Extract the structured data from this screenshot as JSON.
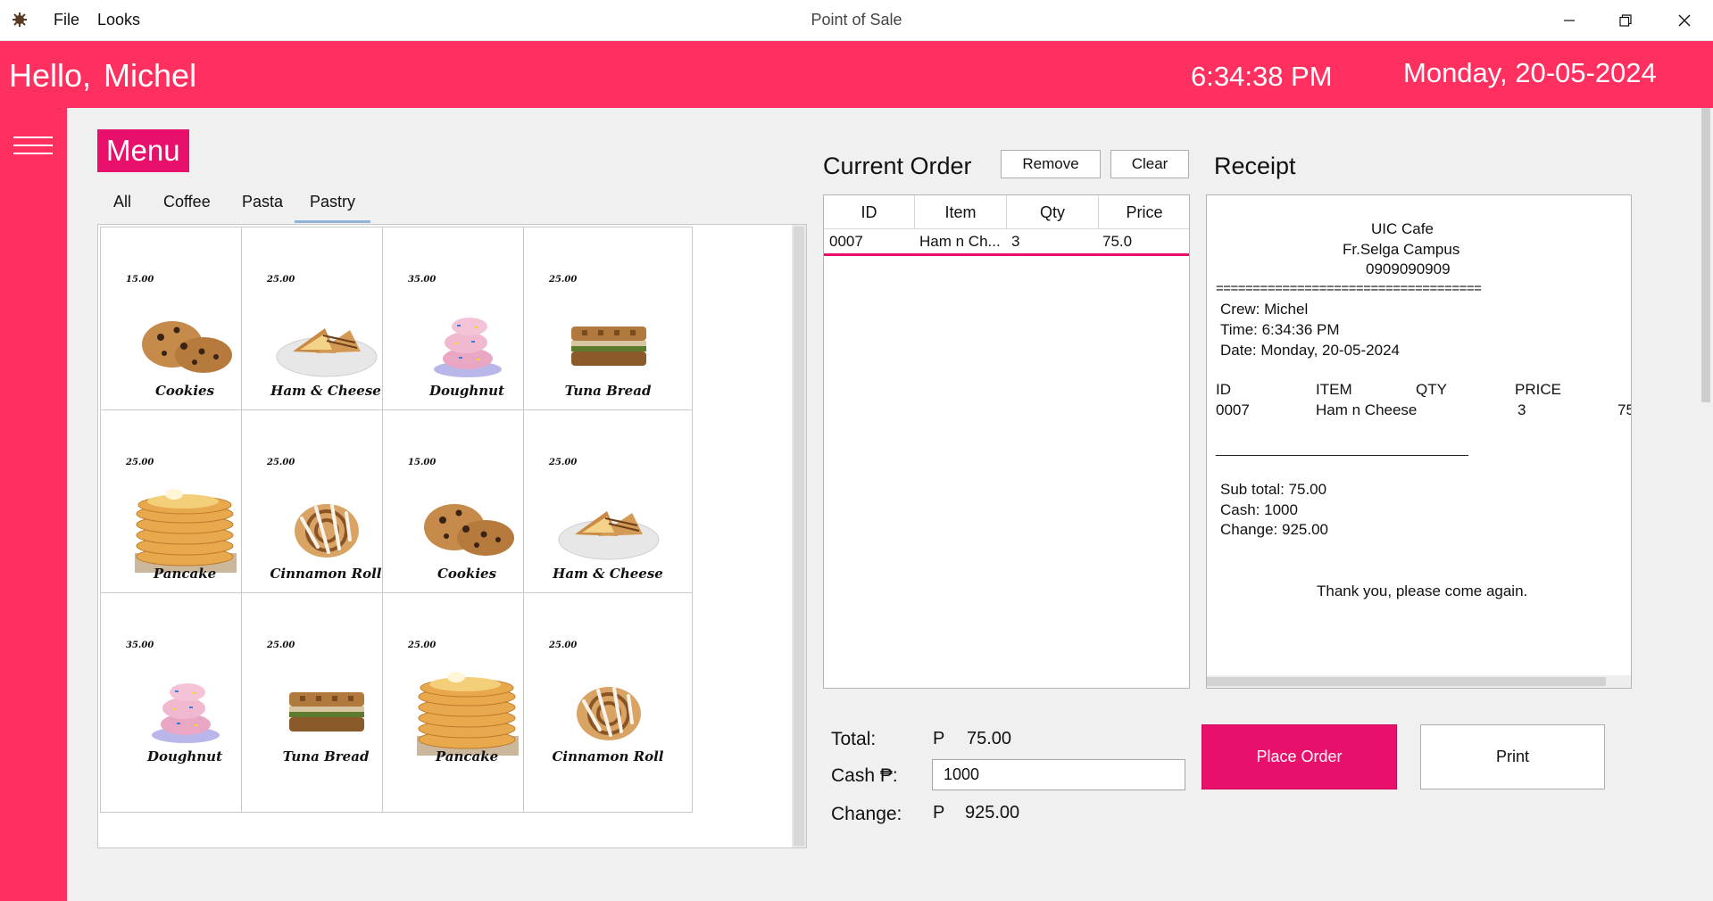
{
  "window": {
    "title": "Point of Sale",
    "menus": [
      "File",
      "Looks"
    ]
  },
  "header": {
    "greeting": "Hello,",
    "user": "Michel",
    "time": "6:34:38 PM",
    "date": "Monday, 20-05-2024",
    "accent_color": "#ff2f5f"
  },
  "menu": {
    "title": "Menu",
    "tabs": [
      "All",
      "Coffee",
      "Pasta",
      "Pastry"
    ],
    "active_tab": "Pastry",
    "items": [
      {
        "name": "Cookies",
        "price": "15.00",
        "icon": "cookies"
      },
      {
        "name": "Ham & Cheese",
        "price": "25.00",
        "icon": "sandwich-plate"
      },
      {
        "name": "Doughnut",
        "price": "35.00",
        "icon": "doughnut"
      },
      {
        "name": "Tuna Bread",
        "price": "25.00",
        "icon": "tuna-bread"
      },
      {
        "name": "Pancake",
        "price": "25.00",
        "icon": "pancake"
      },
      {
        "name": "Cinnamon Roll",
        "price": "25.00",
        "icon": "cinnamon-roll"
      },
      {
        "name": "Cookies",
        "price": "15.00",
        "icon": "cookies"
      },
      {
        "name": "Ham & Cheese",
        "price": "25.00",
        "icon": "sandwich-plate"
      },
      {
        "name": "Doughnut",
        "price": "35.00",
        "icon": "doughnut"
      },
      {
        "name": "Tuna Bread",
        "price": "25.00",
        "icon": "tuna-bread"
      },
      {
        "name": "Pancake",
        "price": "25.00",
        "icon": "pancake"
      },
      {
        "name": "Cinnamon Roll",
        "price": "25.00",
        "icon": "cinnamon-roll"
      }
    ]
  },
  "order": {
    "title": "Current Order",
    "remove_label": "Remove",
    "clear_label": "Clear",
    "columns": [
      "ID",
      "Item",
      "Qty",
      "Price"
    ],
    "rows": [
      {
        "id": "0007",
        "item": "Ham n Ch...",
        "qty": "3",
        "price": "75.0"
      }
    ]
  },
  "receipt": {
    "title": "Receipt",
    "shop": "UIC Cafe",
    "campus": "Fr.Selga Campus",
    "phone": "0909090909",
    "separator": "====================================",
    "crew": "Crew: Michel",
    "time": "Time: 6:34:36 PM",
    "date": "Date: Monday, 20-05-2024",
    "columns": [
      "ID",
      "ITEM",
      "QTY",
      "PRICE"
    ],
    "line": {
      "id": "0007",
      "item": "Ham n Cheese",
      "qty": "3",
      "price": "75"
    },
    "rule": "____________________________________",
    "subtotal": "Sub total: 75.00",
    "cash": "Cash: 1000",
    "change": "Change: 925.00",
    "thanks": "Thank you, please come again."
  },
  "totals": {
    "total_label": "Total:",
    "total_currency": "P",
    "total_value": "75.00",
    "cash_label": "Cash ₱:",
    "cash_value": "1000",
    "change_label": "Change:",
    "change_currency": "P",
    "change_value": "925.00"
  },
  "actions": {
    "place_order": "Place Order",
    "print": "Print",
    "place_color": "#e8106a"
  }
}
